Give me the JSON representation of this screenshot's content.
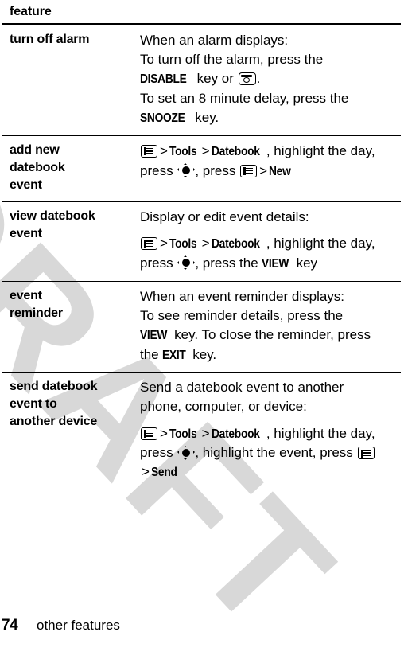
{
  "document": {
    "watermark_text": "DRAFT",
    "watermark_color": "#d8d8d8"
  },
  "table": {
    "header": {
      "feature_label": "feature"
    },
    "rows": [
      {
        "feature": "turn off alarm",
        "paragraphs": [
          {
            "lines": [
              "When an alarm displays:",
              "To turn off the alarm, press the",
              "__DISABLE__ key or __ENDKEY__.",
              "To set an 8 minute delay, press the",
              "__SNOOZE__ key."
            ]
          }
        ],
        "keys": [
          "DISABLE",
          "SNOOZE"
        ],
        "text_segments": {
          "l1": "When an alarm displays:",
          "l2": "To turn off the alarm, press the",
          "l3_key": "DISABLE",
          "l3_mid": "key or",
          "l3_end": ".",
          "l4": "To set an 8 minute delay, press the",
          "l5_key": "SNOOZE",
          "l5_end": "key."
        }
      },
      {
        "feature": "add new datebook event",
        "feature_lines": [
          "add new",
          "datebook",
          "event"
        ],
        "path": {
          "menu_icon": "menu-key-icon",
          "sep1": ">",
          "tools": "Tools",
          "sep2": ">",
          "datebook": "Datebook",
          "after_datebook": ", highlight the day,",
          "press1": "press",
          "center_icon": "center-select-key-icon",
          "press2": ", press",
          "sep3": ">",
          "action": "New"
        }
      },
      {
        "feature": "view datebook event",
        "feature_lines": [
          "view datebook",
          "event"
        ],
        "intro": "Display or edit event details:",
        "path": {
          "menu_icon": "menu-key-icon",
          "sep1": ">",
          "tools": "Tools",
          "sep2": ">",
          "datebook": "Datebook",
          "after_datebook": ", highlight the day,",
          "press1": "press",
          "center_icon": "center-select-key-icon",
          "press2": ", press the",
          "action": "VIEW",
          "tail": "key"
        }
      },
      {
        "feature": "event reminder",
        "feature_lines": [
          "event",
          "reminder"
        ],
        "text_segments": {
          "l1": "When an event reminder displays:",
          "l2": "To see reminder details, press the",
          "l3_key": "VIEW",
          "l3_rest": "key. To close the reminder, press",
          "l4_pre": "the",
          "l4_key": "EXIT",
          "l4_end": "key."
        }
      },
      {
        "feature": "send datebook event to another device",
        "feature_lines": [
          "send datebook",
          "event to",
          "another device"
        ],
        "intro_lines": [
          "Send a datebook event to another",
          "phone, computer, or device:"
        ],
        "path": {
          "menu_icon": "menu-key-icon",
          "sep1": ">",
          "tools": "Tools",
          "sep2": ">",
          "datebook": "Datebook",
          "after_datebook": ", highlight the day,",
          "press1": "press",
          "center_icon": "center-select-key-icon",
          "press2": ", highlight the event, press",
          "sep3": ">",
          "action": "Send"
        }
      }
    ]
  },
  "footer": {
    "page_number": "74",
    "section_name": "other features"
  }
}
